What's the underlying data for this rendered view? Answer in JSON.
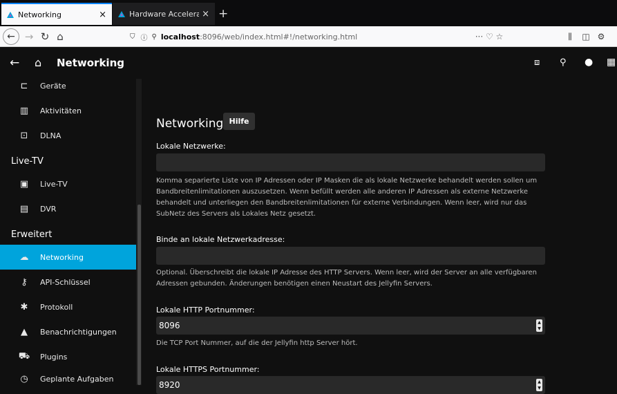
{
  "browser": {
    "tabs": [
      {
        "title": "Networking",
        "close": "×"
      },
      {
        "title": "Hardware Acceleration |",
        "close": "×"
      }
    ],
    "new_tab": "+",
    "url": {
      "prefix": "localhost",
      "rest": ":8096/web/index.html#!/networking.html"
    },
    "url_actions": "··· ♡ ☆"
  },
  "header": {
    "title": "Networking"
  },
  "sidebar": {
    "items_top": [
      {
        "label": "Geräte",
        "icon": "devices-icon"
      },
      {
        "label": "Aktivitäten",
        "icon": "activity-icon"
      },
      {
        "label": "DLNA",
        "icon": "dlna-icon"
      }
    ],
    "section_livetv": "Live-TV",
    "items_livetv": [
      {
        "label": "Live-TV",
        "icon": "tv-icon"
      },
      {
        "label": "DVR",
        "icon": "dvr-icon"
      }
    ],
    "section_advanced": "Erweitert",
    "items_advanced": [
      {
        "label": "Networking",
        "icon": "cloud-icon"
      },
      {
        "label": "API-Schlüssel",
        "icon": "key-icon"
      },
      {
        "label": "Protokoll",
        "icon": "bug-icon"
      },
      {
        "label": "Benachrichtigungen",
        "icon": "bell-icon"
      },
      {
        "label": "Plugins",
        "icon": "cart-icon"
      },
      {
        "label": "Geplante Aufgaben",
        "icon": "clock-icon"
      }
    ]
  },
  "main": {
    "title": "Networking",
    "help_button": "Hilfe",
    "local_networks": {
      "label": "Lokale Netzwerke:",
      "value": "",
      "help": "Komma separierte Liste von IP Adressen oder IP Masken die als lokale Netzwerke behandelt werden sollen um Bandbreitenlimitationen auszusetzen. Wenn befüllt werden alle anderen IP Adressen als externe Netzwerke behandelt und unterliegen den Bandbreitenlimitationen für externe Verbindungen. Wenn leer, wird nur das SubNetz des Servers als Lokales Netz gesetzt."
    },
    "bind_address": {
      "label": "Binde an lokale Netzwerkadresse:",
      "value": "",
      "help": "Optional. Überschreibt die lokale IP Adresse des HTTP Servers. Wenn leer, wird der Server an alle verfügbaren Adressen gebunden. Änderungen benötigen einen Neustart des Jellyfin Servers."
    },
    "http_port": {
      "label": "Lokale HTTP Portnummer:",
      "value": "8096",
      "help": "Die TCP Port Nummer, auf die der Jellyfin http Server hört."
    },
    "https_port": {
      "label": "Lokale HTTPS Portnummer:",
      "value": "8920"
    }
  }
}
